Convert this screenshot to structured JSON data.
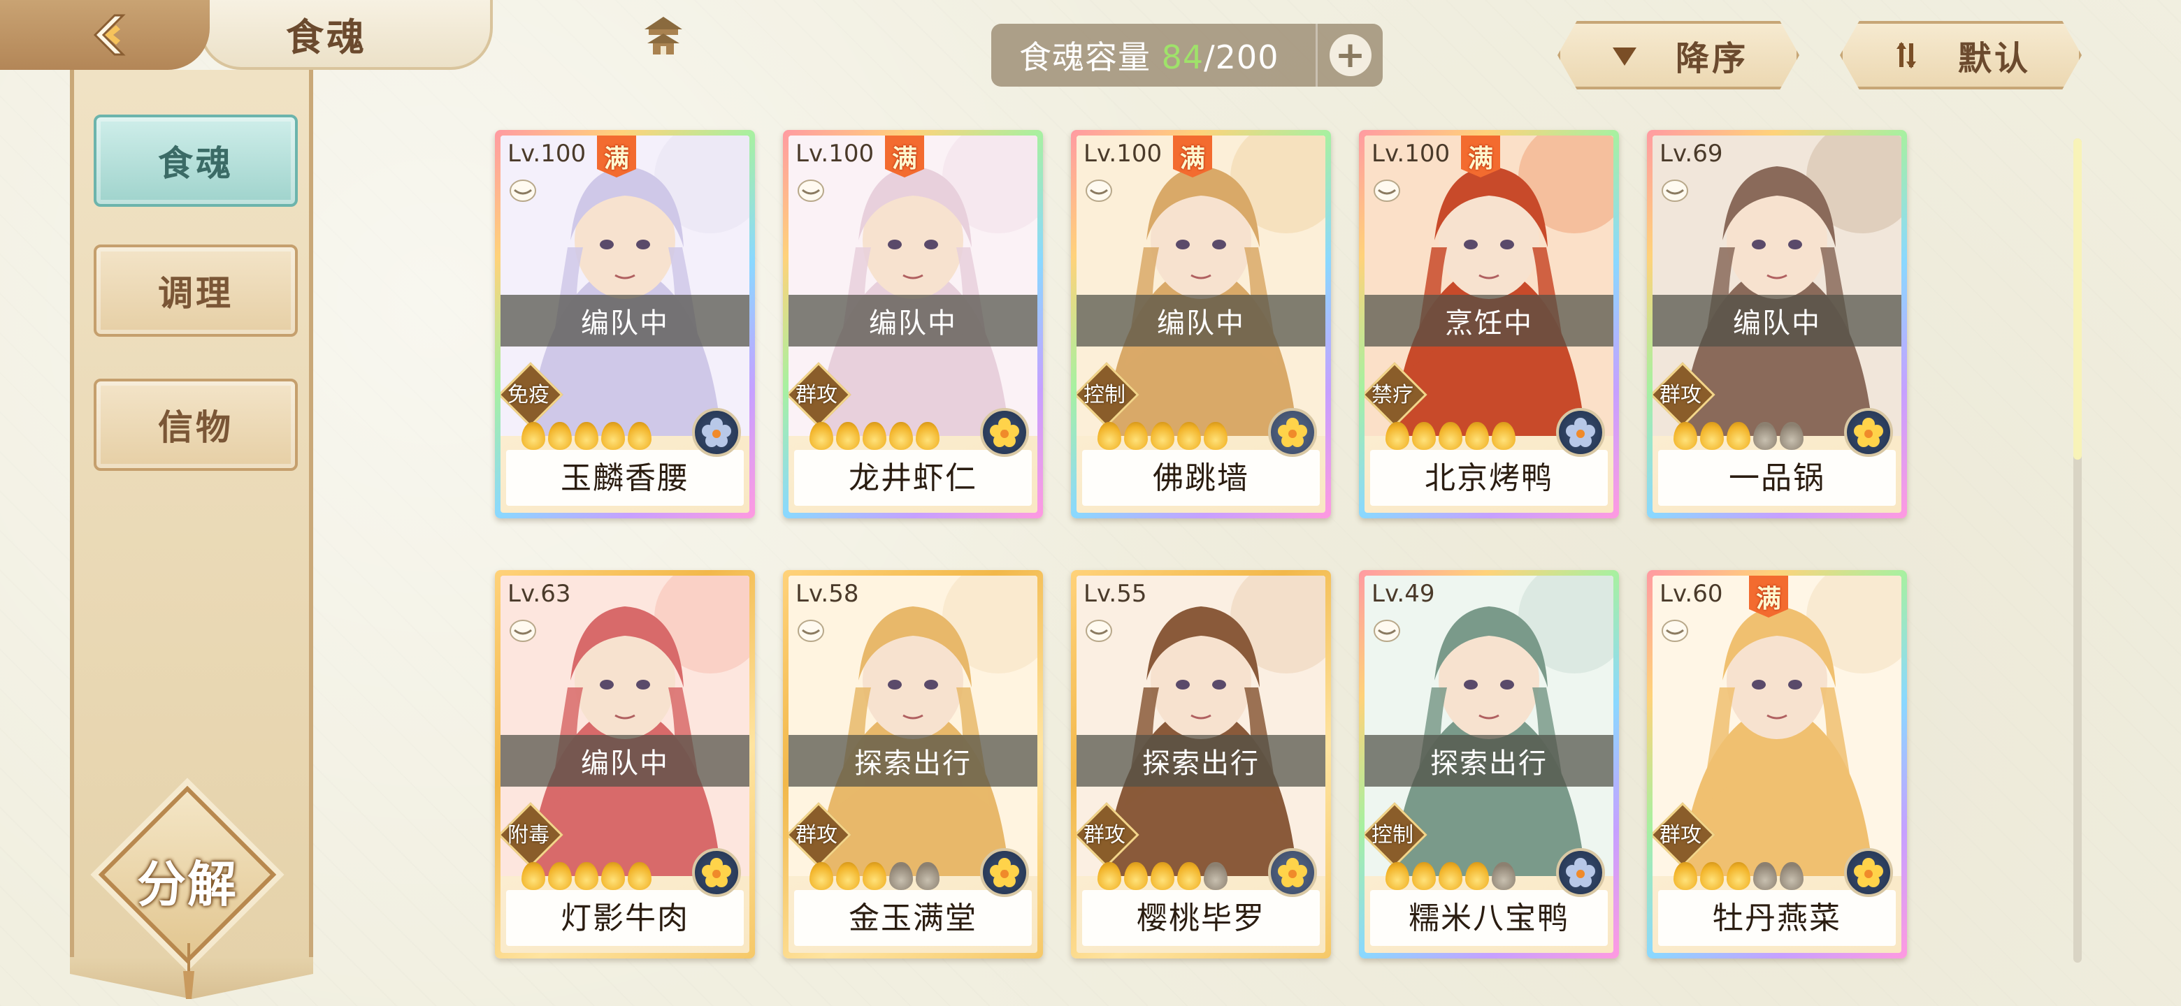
{
  "header": {
    "title": "食魂",
    "capacity_label": "食魂容量 ",
    "capacity_current": "84",
    "capacity_max": "/200",
    "plus": "+",
    "sort_order": "降序",
    "sort_mode": "默认"
  },
  "sidebar": {
    "items": [
      {
        "label": "食魂",
        "active": true
      },
      {
        "label": "调理",
        "active": false
      },
      {
        "label": "信物",
        "active": false
      }
    ],
    "decompose": "分解"
  },
  "cards": [
    {
      "level": "Lv.100",
      "full": "满",
      "status": "编队中",
      "tag": "免疫",
      "flames_on": 5,
      "name": "玉麟香腰"
    },
    {
      "level": "Lv.100",
      "full": "满",
      "status": "编队中",
      "tag": "群攻",
      "flames_on": 5,
      "name": "龙井虾仁"
    },
    {
      "level": "Lv.100",
      "full": "满",
      "status": "编队中",
      "tag": "控制",
      "flames_on": 5,
      "name": "佛跳墙"
    },
    {
      "level": "Lv.100",
      "full": "满",
      "status": "烹饪中",
      "tag": "禁疗",
      "flames_on": 5,
      "name": "北京烤鸭"
    },
    {
      "level": "Lv.69",
      "full": "",
      "status": "编队中",
      "tag": "群攻",
      "flames_on": 3,
      "name": "一品锅"
    },
    {
      "level": "Lv.63",
      "full": "",
      "status": "编队中",
      "tag": "附毒",
      "flames_on": 5,
      "name": "灯影牛肉"
    },
    {
      "level": "Lv.58",
      "full": "",
      "status": "探索出行",
      "tag": "群攻",
      "flames_on": 3,
      "name": "金玉满堂"
    },
    {
      "level": "Lv.55",
      "full": "",
      "status": "探索出行",
      "tag": "群攻",
      "flames_on": 4,
      "name": "樱桃毕罗"
    },
    {
      "level": "Lv.49",
      "full": "",
      "status": "探索出行",
      "tag": "控制",
      "flames_on": 4,
      "name": "糯米八宝鸭"
    },
    {
      "level": "Lv.60",
      "full": "满",
      "status": "",
      "tag": "群攻",
      "flames_on": 3,
      "name": "牡丹燕菜"
    }
  ],
  "colors": {
    "accent_green": "#9fe26a",
    "full_badge": "#f36b2f",
    "active_tab": "#9fd3cc"
  },
  "icons": [
    "back-icon",
    "pagoda-icon",
    "plus-icon",
    "sort-desc-icon",
    "sort-default-icon",
    "bowl-icon",
    "flame-icon",
    "element-flower-icon"
  ]
}
